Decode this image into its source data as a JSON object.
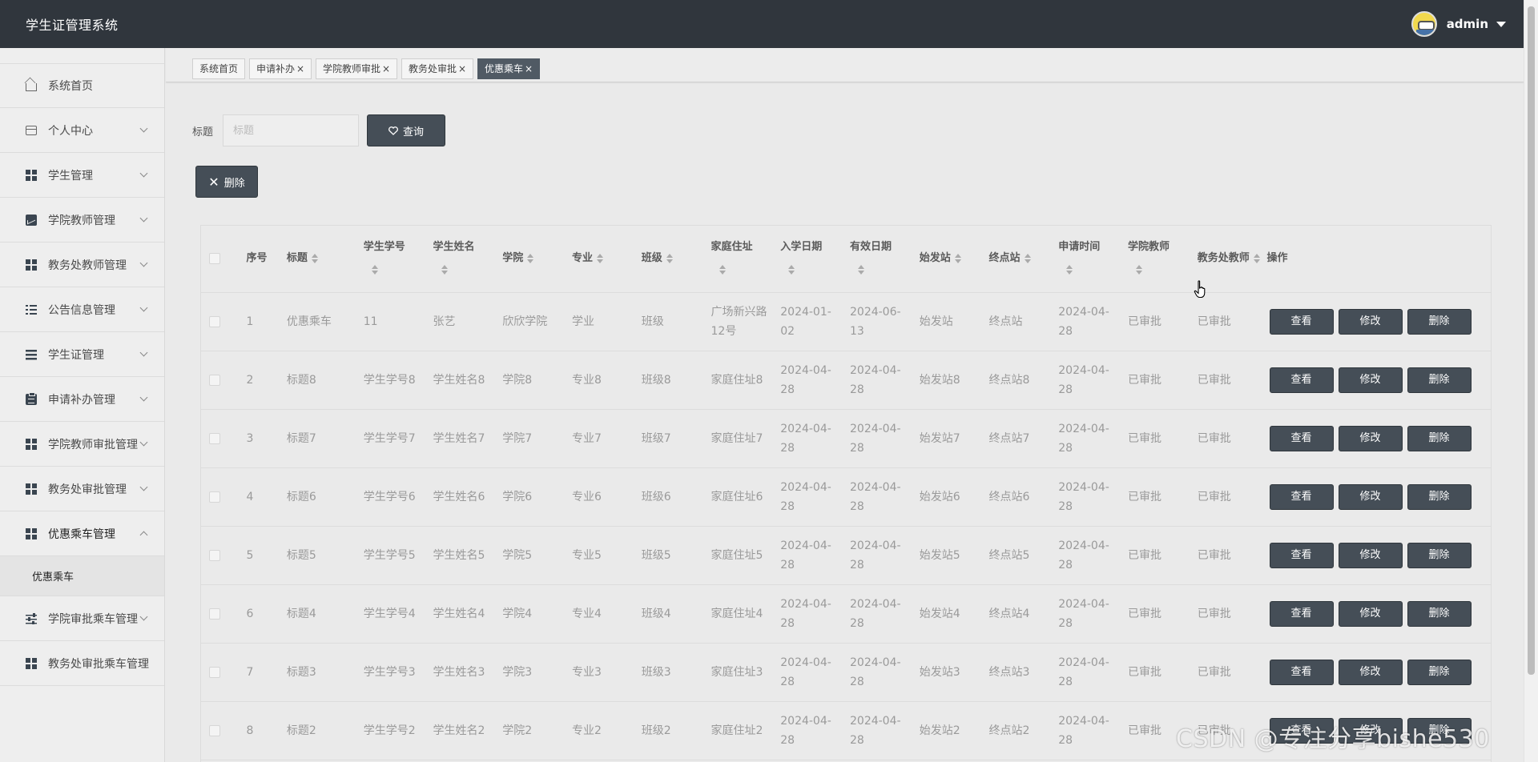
{
  "header": {
    "app_title": "学生证管理系统",
    "username": "admin"
  },
  "sidebar": {
    "items": [
      {
        "label": "系统首页",
        "icon": "home-icon"
      },
      {
        "label": "个人中心",
        "icon": "card-icon"
      },
      {
        "label": "学生管理",
        "icon": "grid-icon"
      },
      {
        "label": "学院教师管理",
        "icon": "chart-icon"
      },
      {
        "label": "教务处教师管理",
        "icon": "grid-icon"
      },
      {
        "label": "公告信息管理",
        "icon": "list-icon"
      },
      {
        "label": "学生证管理",
        "icon": "lines-icon"
      },
      {
        "label": "申请补办管理",
        "icon": "clipboard-icon"
      },
      {
        "label": "学院教师审批管理",
        "icon": "grid-icon"
      },
      {
        "label": "教务处审批管理",
        "icon": "grid-icon"
      },
      {
        "label": "优惠乘车管理",
        "icon": "grid-icon"
      },
      {
        "label": "学院审批乘车管理",
        "icon": "sliders-icon"
      },
      {
        "label": "教务处审批乘车管理",
        "icon": "grid-icon"
      }
    ],
    "submenu_label": "优惠乘车"
  },
  "tabs": [
    {
      "label": "系统首页"
    },
    {
      "label": "申请补办"
    },
    {
      "label": "学院教师审批"
    },
    {
      "label": "教务处审批"
    },
    {
      "label": "优惠乘车"
    }
  ],
  "tab_close": "×",
  "search": {
    "label": "标题",
    "placeholder": "标题",
    "button_label": "查询"
  },
  "delete_button_label": "删除",
  "table": {
    "headers": {
      "index": "序号",
      "title": "标题",
      "student_no": "学生学号",
      "student_name": "学生姓名",
      "college": "学院",
      "major": "专业",
      "class": "班级",
      "address": "家庭住址",
      "enroll_date": "入学日期",
      "valid_date": "有效日期",
      "start_station": "始发站",
      "end_station": "终点站",
      "apply_time": "申请时间",
      "college_teacher": "学院教师",
      "office_teacher": "教务处教师",
      "actions": "操作"
    },
    "actions": {
      "view": "查看",
      "edit": "修改",
      "delete": "删除"
    },
    "rows": [
      {
        "index": "1",
        "title": "优惠乘车",
        "student_no": "11",
        "student_name": "张艺",
        "college": "欣欣学院",
        "major": "学业",
        "class": "班级",
        "address": "广场新兴路12号",
        "enroll_date": "2024-01-02",
        "valid_date": "2024-06-13",
        "start_station": "始发站",
        "end_station": "终点站",
        "apply_time": "2024-04-28",
        "college_teacher": "已审批",
        "office_teacher": "已审批"
      },
      {
        "index": "2",
        "title": "标题8",
        "student_no": "学生学号8",
        "student_name": "学生姓名8",
        "college": "学院8",
        "major": "专业8",
        "class": "班级8",
        "address": "家庭住址8",
        "enroll_date": "2024-04-28",
        "valid_date": "2024-04-28",
        "start_station": "始发站8",
        "end_station": "终点站8",
        "apply_time": "2024-04-28",
        "college_teacher": "已审批",
        "office_teacher": "已审批"
      },
      {
        "index": "3",
        "title": "标题7",
        "student_no": "学生学号7",
        "student_name": "学生姓名7",
        "college": "学院7",
        "major": "专业7",
        "class": "班级7",
        "address": "家庭住址7",
        "enroll_date": "2024-04-28",
        "valid_date": "2024-04-28",
        "start_station": "始发站7",
        "end_station": "终点站7",
        "apply_time": "2024-04-28",
        "college_teacher": "已审批",
        "office_teacher": "已审批"
      },
      {
        "index": "4",
        "title": "标题6",
        "student_no": "学生学号6",
        "student_name": "学生姓名6",
        "college": "学院6",
        "major": "专业6",
        "class": "班级6",
        "address": "家庭住址6",
        "enroll_date": "2024-04-28",
        "valid_date": "2024-04-28",
        "start_station": "始发站6",
        "end_station": "终点站6",
        "apply_time": "2024-04-28",
        "college_teacher": "已审批",
        "office_teacher": "已审批"
      },
      {
        "index": "5",
        "title": "标题5",
        "student_no": "学生学号5",
        "student_name": "学生姓名5",
        "college": "学院5",
        "major": "专业5",
        "class": "班级5",
        "address": "家庭住址5",
        "enroll_date": "2024-04-28",
        "valid_date": "2024-04-28",
        "start_station": "始发站5",
        "end_station": "终点站5",
        "apply_time": "2024-04-28",
        "college_teacher": "已审批",
        "office_teacher": "已审批"
      },
      {
        "index": "6",
        "title": "标题4",
        "student_no": "学生学号4",
        "student_name": "学生姓名4",
        "college": "学院4",
        "major": "专业4",
        "class": "班级4",
        "address": "家庭住址4",
        "enroll_date": "2024-04-28",
        "valid_date": "2024-04-28",
        "start_station": "始发站4",
        "end_station": "终点站4",
        "apply_time": "2024-04-28",
        "college_teacher": "已审批",
        "office_teacher": "已审批"
      },
      {
        "index": "7",
        "title": "标题3",
        "student_no": "学生学号3",
        "student_name": "学生姓名3",
        "college": "学院3",
        "major": "专业3",
        "class": "班级3",
        "address": "家庭住址3",
        "enroll_date": "2024-04-28",
        "valid_date": "2024-04-28",
        "start_station": "始发站3",
        "end_station": "终点站3",
        "apply_time": "2024-04-28",
        "college_teacher": "已审批",
        "office_teacher": "已审批"
      },
      {
        "index": "8",
        "title": "标题2",
        "student_no": "学生学号2",
        "student_name": "学生姓名2",
        "college": "学院2",
        "major": "专业2",
        "class": "班级2",
        "address": "家庭住址2",
        "enroll_date": "2024-04-28",
        "valid_date": "2024-04-28",
        "start_station": "始发站2",
        "end_station": "终点站2",
        "apply_time": "2024-04-28",
        "college_teacher": "已审批",
        "office_teacher": "已审批"
      }
    ]
  },
  "watermark": "CSDN @专注分享bishe530"
}
